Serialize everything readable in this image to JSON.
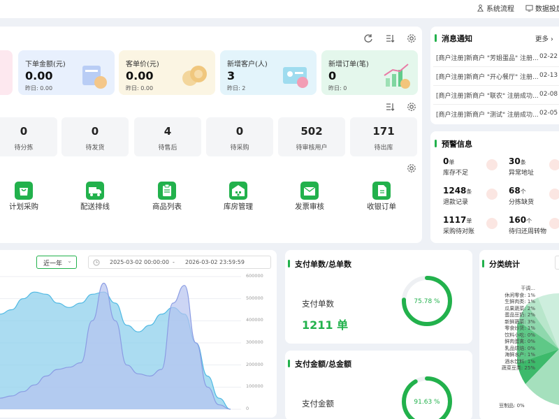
{
  "topbar": {
    "links": [
      "系统流程",
      "数据投屏"
    ]
  },
  "summary_cards": [
    {
      "title": "下单金额(元)",
      "value": "0.00",
      "yesterday": "昨日: 0.00",
      "bg": "#e8f0fd"
    },
    {
      "title": "客单价(元)",
      "value": "0.00",
      "yesterday": "昨日: 0.00",
      "bg": "#fbf5e3"
    },
    {
      "title": "新增客户(人)",
      "value": "3",
      "yesterday": "昨日: 2",
      "bg": "#e3f4fb"
    },
    {
      "title": "新增订单(笔)",
      "value": "0",
      "yesterday": "昨日: 0",
      "bg": "#e4f7ec"
    }
  ],
  "stats": [
    {
      "value": "0",
      "label": "待分拣"
    },
    {
      "value": "0",
      "label": "待发货"
    },
    {
      "value": "4",
      "label": "待售后"
    },
    {
      "value": "0",
      "label": "待采购"
    },
    {
      "value": "502",
      "label": "待审核用户"
    },
    {
      "value": "171",
      "label": "待出库"
    }
  ],
  "quick_actions": [
    {
      "label": "计划采购",
      "icon": "shopping-bag-icon"
    },
    {
      "label": "配送排线",
      "icon": "truck-icon"
    },
    {
      "label": "商品列表",
      "icon": "clipboard-icon"
    },
    {
      "label": "库房管理",
      "icon": "warehouse-icon"
    },
    {
      "label": "发票审核",
      "icon": "envelope-icon"
    },
    {
      "label": "收银订单",
      "icon": "document-icon"
    }
  ],
  "messages": {
    "title": "消息通知",
    "more": "更多 ›",
    "items": [
      {
        "text": "[商户注册]新商户 \"芳姐蛋品\" 注册...",
        "date": "02-22"
      },
      {
        "text": "[商户注册]新商户 \"开心餐厅\" 注册...",
        "date": "02-13"
      },
      {
        "text": "[商户注册]新商户 \"联农\" 注册成功...",
        "date": "02-08"
      },
      {
        "text": "[商户注册]新商户 \"测试\" 注册成功...",
        "date": "02-05"
      }
    ]
  },
  "warnings": {
    "title": "预警信息",
    "items": [
      {
        "value": "0",
        "unit": "单",
        "label": "库存不足"
      },
      {
        "value": "30",
        "unit": "条",
        "label": "异常地址"
      },
      {
        "value": "1248",
        "unit": "条",
        "label": "退款记录"
      },
      {
        "value": "68",
        "unit": "个",
        "label": "分拣缺货"
      },
      {
        "value": "1117",
        "unit": "单",
        "label": "采购待对账"
      },
      {
        "value": "160",
        "unit": "个",
        "label": "待归还周转物"
      }
    ]
  },
  "trend": {
    "range_select": "近一年",
    "date_start": "2025-03-02 00:00:00",
    "date_sep": "-",
    "date_end": "2026-03-02 23:59:59"
  },
  "chart_data": {
    "type": "area",
    "title": "",
    "ylim": [
      0,
      600000
    ],
    "y_ticks": [
      "600000",
      "500000",
      "400000",
      "300000",
      "200000",
      "100000",
      "0"
    ],
    "x": [
      0,
      1,
      2,
      3,
      4,
      5,
      6,
      7,
      8,
      9,
      10,
      11,
      12,
      13,
      14,
      15,
      16,
      17,
      18,
      19,
      20
    ],
    "series": [
      {
        "values": [
          430000,
          450000,
          500000,
          530000,
          520000,
          480000,
          460000,
          480000,
          520000,
          530000,
          480000,
          380000,
          350000,
          380000,
          430000,
          460000,
          430000,
          300000,
          150000,
          50000,
          0
        ]
      },
      {
        "values": [
          50000,
          60000,
          80000,
          110000,
          150000,
          180000,
          190000,
          210000,
          400000,
          570000,
          400000,
          200000,
          160000,
          150000,
          180000,
          480000,
          560000,
          300000,
          100000,
          20000,
          0
        ]
      }
    ],
    "colors": [
      "#8fd0ec",
      "#b7c3ef"
    ]
  },
  "pay_count": {
    "title": "支付单数/总单数",
    "label": "支付单数",
    "value": "1211 单",
    "percent_text": "75.78 %",
    "percent": 75.78
  },
  "pay_amount": {
    "title": "支付金额/总金额",
    "label": "支付金额",
    "percent_text": "91.63 %",
    "percent": 91.63
  },
  "category": {
    "title": "分类统计",
    "labels": [
      "干调...",
      "休闲零食: 1%",
      "生鲜肉类: 1%",
      "瓜果蔬菜: 2%",
      "蛋品豆奶: 2%",
      "新鲜蔬菜: 3%",
      "零食炒货: 1%",
      "饮料小吃: 0%",
      "鲜肉蛋禽: 0%",
      "乳品烘焙: 0%",
      "海鲜水产: 1%",
      "酒水饮料: 1%",
      "蔬菜豆类: 25%",
      "豆制品: 0%"
    ]
  },
  "colors": {
    "accent": "#22b14c",
    "panel": "#ffffff",
    "background": "#eef1f6"
  }
}
